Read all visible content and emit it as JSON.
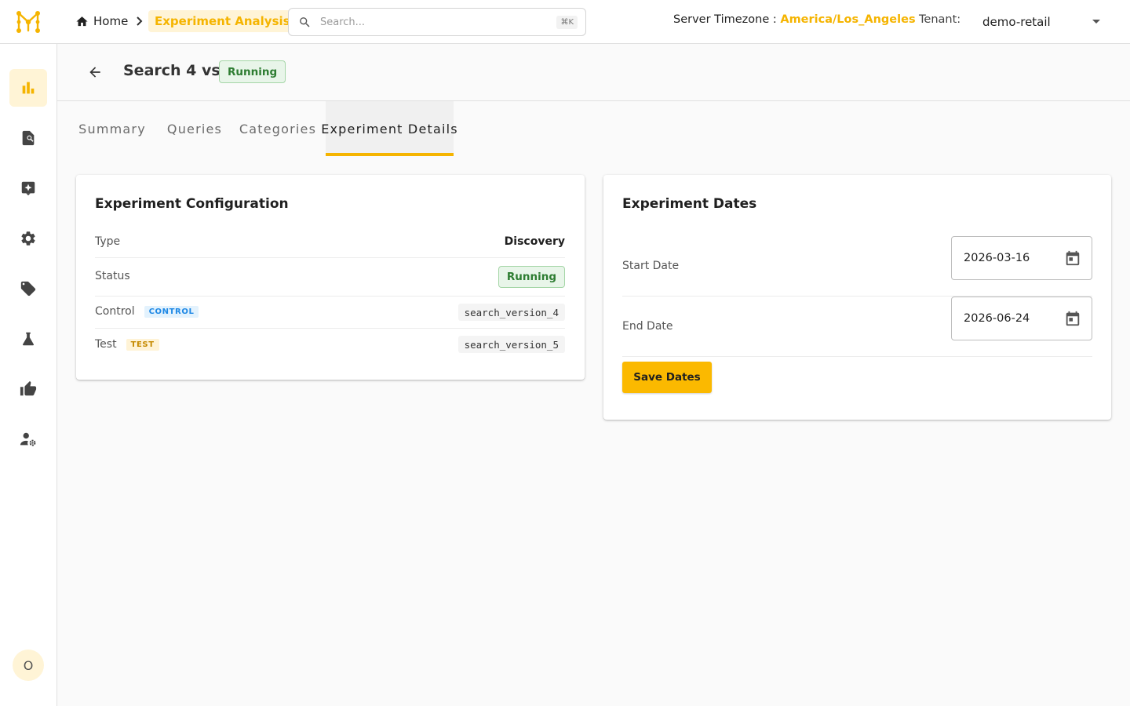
{
  "colors": {
    "accent": "#f5b400",
    "success": "#2e7d32",
    "control": "#1e88e5"
  },
  "header": {
    "breadcrumb": {
      "home_label": "Home",
      "home_icon": "home-icon",
      "separator_icon": "chevron-right-icon",
      "current_label": "Experiment Analysis"
    },
    "search": {
      "placeholder": "Search...",
      "shortcut": "⌘K",
      "icon": "search-icon"
    },
    "timezone": {
      "label": "Server Timezone :",
      "value": "America/Los_Angeles"
    },
    "tenant": {
      "label": "Tenant:",
      "value": "demo-retail"
    }
  },
  "sidebar": {
    "items": [
      {
        "name": "analytics",
        "icon": "bar-chart-icon",
        "active": true
      },
      {
        "name": "search-insights",
        "icon": "document-search-icon"
      },
      {
        "name": "ai-boost",
        "icon": "sparkle-box-icon"
      },
      {
        "name": "settings",
        "icon": "gear-icon"
      },
      {
        "name": "tags",
        "icon": "tag-icon"
      },
      {
        "name": "experiments",
        "icon": "flask-icon"
      },
      {
        "name": "feedback",
        "icon": "thumbs-up-icon"
      },
      {
        "name": "user-settings",
        "icon": "user-gear-icon"
      }
    ],
    "avatar_initial": "O"
  },
  "page": {
    "title": "Search 4 vs 5",
    "status": "Running",
    "tabs": [
      {
        "label": "Summary"
      },
      {
        "label": "Queries"
      },
      {
        "label": "Categories"
      },
      {
        "label": "Experiment Details",
        "active": true
      }
    ]
  },
  "config": {
    "title": "Experiment Configuration",
    "type_label": "Type",
    "type_value": "Discovery",
    "status_label": "Status",
    "status_value": "Running",
    "control_label": "Control",
    "control_chip": "CONTROL",
    "control_value": "search_version_4",
    "test_label": "Test",
    "test_chip": "TEST",
    "test_value": "search_version_5"
  },
  "dates": {
    "title": "Experiment Dates",
    "start_label": "Start Date",
    "start_value": "2026-03-16",
    "end_label": "End Date",
    "end_value": "2026-06-24",
    "save_label": "Save Dates"
  }
}
